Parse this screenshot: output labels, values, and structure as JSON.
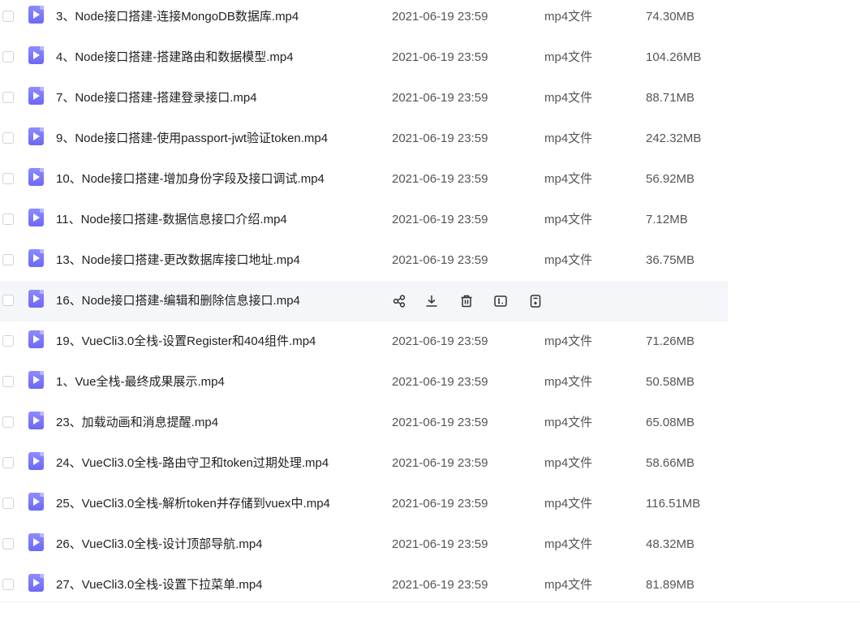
{
  "files": [
    {
      "name": "3、Node接口搭建-连接MongoDB数据库.mp4",
      "date": "2021-06-19 23:59",
      "type": "mp4文件",
      "size": "74.30MB"
    },
    {
      "name": "4、Node接口搭建-搭建路由和数据模型.mp4",
      "date": "2021-06-19 23:59",
      "type": "mp4文件",
      "size": "104.26MB"
    },
    {
      "name": "7、Node接口搭建-搭建登录接口.mp4",
      "date": "2021-06-19 23:59",
      "type": "mp4文件",
      "size": "88.71MB"
    },
    {
      "name": "9、Node接口搭建-使用passport-jwt验证token.mp4",
      "date": "2021-06-19 23:59",
      "type": "mp4文件",
      "size": "242.32MB"
    },
    {
      "name": "10、Node接口搭建-增加身份字段及接口调试.mp4",
      "date": "2021-06-19 23:59",
      "type": "mp4文件",
      "size": "56.92MB"
    },
    {
      "name": "11、Node接口搭建-数据信息接口介绍.mp4",
      "date": "2021-06-19 23:59",
      "type": "mp4文件",
      "size": "7.12MB"
    },
    {
      "name": "13、Node接口搭建-更改数据库接口地址.mp4",
      "date": "2021-06-19 23:59",
      "type": "mp4文件",
      "size": "36.75MB"
    },
    {
      "name": "16、Node接口搭建-编辑和删除信息接口.mp4",
      "hovered": true
    },
    {
      "name": "19、VueCli3.0全栈-设置Register和404组件.mp4",
      "date": "2021-06-19 23:59",
      "type": "mp4文件",
      "size": "71.26MB"
    },
    {
      "name": "1、Vue全栈-最终成果展示.mp4",
      "date": "2021-06-19 23:59",
      "type": "mp4文件",
      "size": "50.58MB"
    },
    {
      "name": "23、加载动画和消息提醒.mp4",
      "date": "2021-06-19 23:59",
      "type": "mp4文件",
      "size": "65.08MB"
    },
    {
      "name": "24、VueCli3.0全栈-路由守卫和token过期处理.mp4",
      "date": "2021-06-19 23:59",
      "type": "mp4文件",
      "size": "58.66MB"
    },
    {
      "name": "25、VueCli3.0全栈-解析token并存储到vuex中.mp4",
      "date": "2021-06-19 23:59",
      "type": "mp4文件",
      "size": "116.51MB"
    },
    {
      "name": "26、VueCli3.0全栈-设计顶部导航.mp4",
      "date": "2021-06-19 23:59",
      "type": "mp4文件",
      "size": "48.32MB"
    },
    {
      "name": "27、VueCli3.0全栈-设置下拉菜单.mp4",
      "date": "2021-06-19 23:59",
      "type": "mp4文件",
      "size": "81.89MB"
    }
  ],
  "hover_actions": [
    "share-icon",
    "download-icon",
    "delete-icon",
    "rename-icon",
    "move-icon"
  ],
  "colors": {
    "file_icon": "#7b78ff",
    "hover_row": "#f5f6fa",
    "text_primary": "#222222",
    "text_secondary": "#555555"
  }
}
